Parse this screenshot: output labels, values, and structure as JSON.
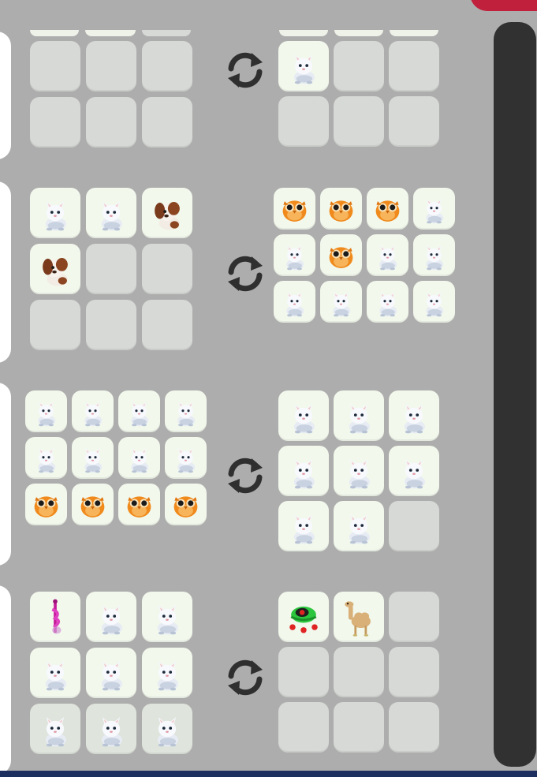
{
  "colors": {
    "background": "#adadad",
    "empty_slot": "#d6d9d5",
    "filled_slot": "#f2f8ec",
    "swap_icon": "#2f2f2f",
    "scrollbar": "#313131",
    "accent_badge": "#c0203b"
  },
  "trades": [
    {
      "offer": [
        "empty",
        "empty",
        "empty",
        "empty",
        "empty",
        "empty"
      ],
      "receive": [
        "white-cat-pet-icon",
        "empty",
        "empty",
        "empty",
        "empty",
        "empty"
      ]
    },
    {
      "offer": [
        "white-cat-pet-icon",
        "white-cat-pet-icon",
        "brown-dog-pet-icon",
        "brown-dog-pet-icon",
        "empty",
        "empty",
        "empty",
        "empty",
        "empty"
      ],
      "receive": [
        "orange-owl-pet-icon",
        "orange-owl-pet-icon",
        "orange-owl-pet-icon",
        "white-cat-pet-icon",
        "white-cat-pet-icon",
        "orange-owl-pet-icon",
        "white-cat-pet-icon",
        "white-cat-pet-icon",
        "white-cat-pet-icon",
        "white-cat-pet-icon",
        "white-cat-pet-icon",
        "white-cat-pet-icon"
      ]
    },
    {
      "offer": [
        "white-cat-pet-icon",
        "white-cat-pet-icon",
        "white-cat-pet-icon",
        "white-cat-pet-icon",
        "white-cat-pet-icon",
        "white-cat-pet-icon",
        "white-cat-pet-icon",
        "white-cat-pet-icon",
        "orange-owl-pet-icon",
        "orange-owl-pet-icon",
        "orange-owl-pet-icon",
        "orange-owl-pet-icon"
      ],
      "receive": [
        "white-cat-pet-icon",
        "white-cat-pet-icon",
        "white-cat-pet-icon",
        "white-cat-pet-icon",
        "white-cat-pet-icon",
        "white-cat-pet-icon",
        "white-cat-pet-icon",
        "white-cat-pet-icon",
        "empty"
      ]
    },
    {
      "offer": [
        "pink-wand-item-icon",
        "white-cat-pet-icon",
        "white-cat-pet-icon",
        "white-cat-pet-icon",
        "white-cat-pet-icon",
        "white-cat-pet-icon",
        "white-cat-pet-icon",
        "white-cat-pet-icon",
        "white-cat-pet-icon"
      ],
      "receive": [
        "green-frog-hat-item-icon",
        "camel-pet-icon",
        "empty",
        "empty",
        "empty",
        "empty",
        "empty",
        "empty",
        "empty"
      ]
    }
  ],
  "swap_icon": "swap-arrows-icon"
}
